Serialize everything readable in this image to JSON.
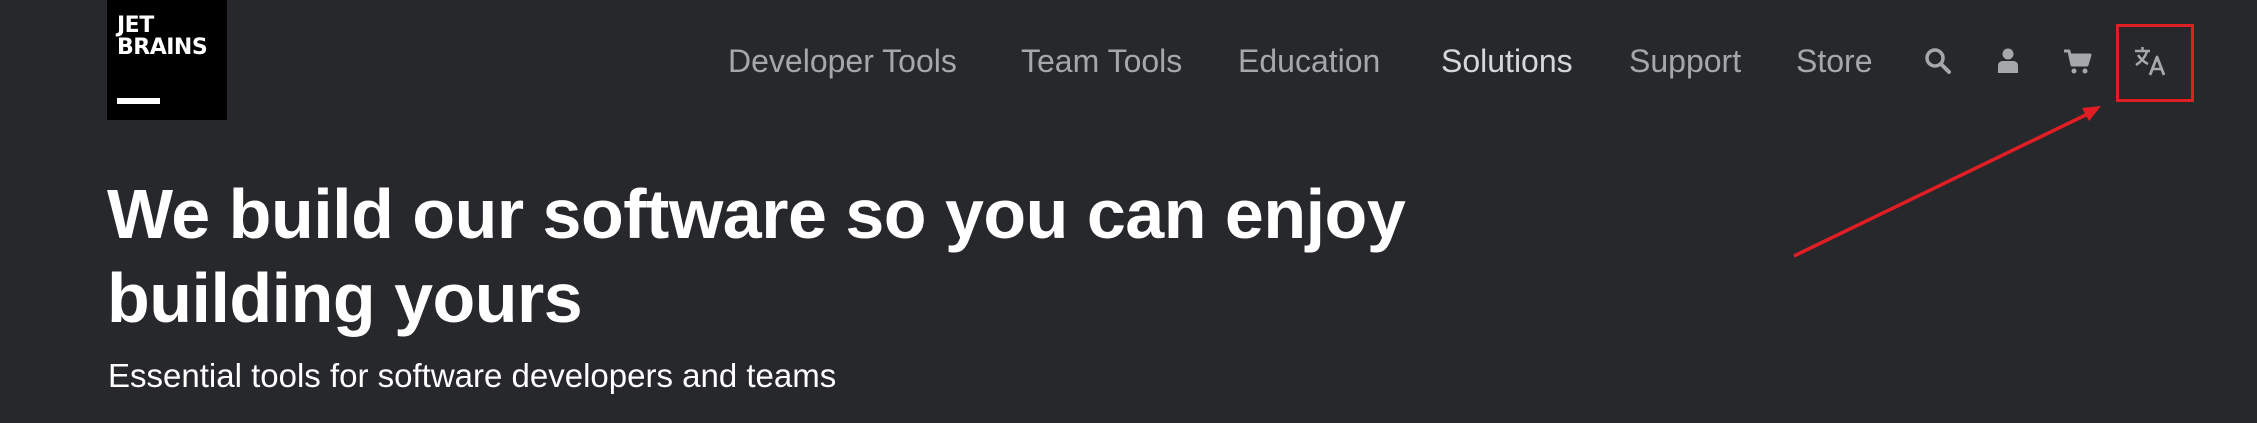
{
  "logo": {
    "line1": "JET",
    "line2": "BRAINS"
  },
  "nav": {
    "items": [
      {
        "label": "Developer Tools"
      },
      {
        "label": "Team Tools"
      },
      {
        "label": "Education"
      },
      {
        "label": "Solutions",
        "active": true
      },
      {
        "label": "Support"
      },
      {
        "label": "Store"
      }
    ],
    "icons": [
      "search-icon",
      "user-icon",
      "cart-icon",
      "language-icon"
    ]
  },
  "hero": {
    "title": "We build our software so you can enjoy building yours",
    "subtitle": "Essential tools for software developers and teams"
  },
  "colors": {
    "background": "#27282c",
    "nav_text": "#a6a7ab",
    "nav_active": "#d6d7da",
    "highlight": "#e01e24"
  }
}
